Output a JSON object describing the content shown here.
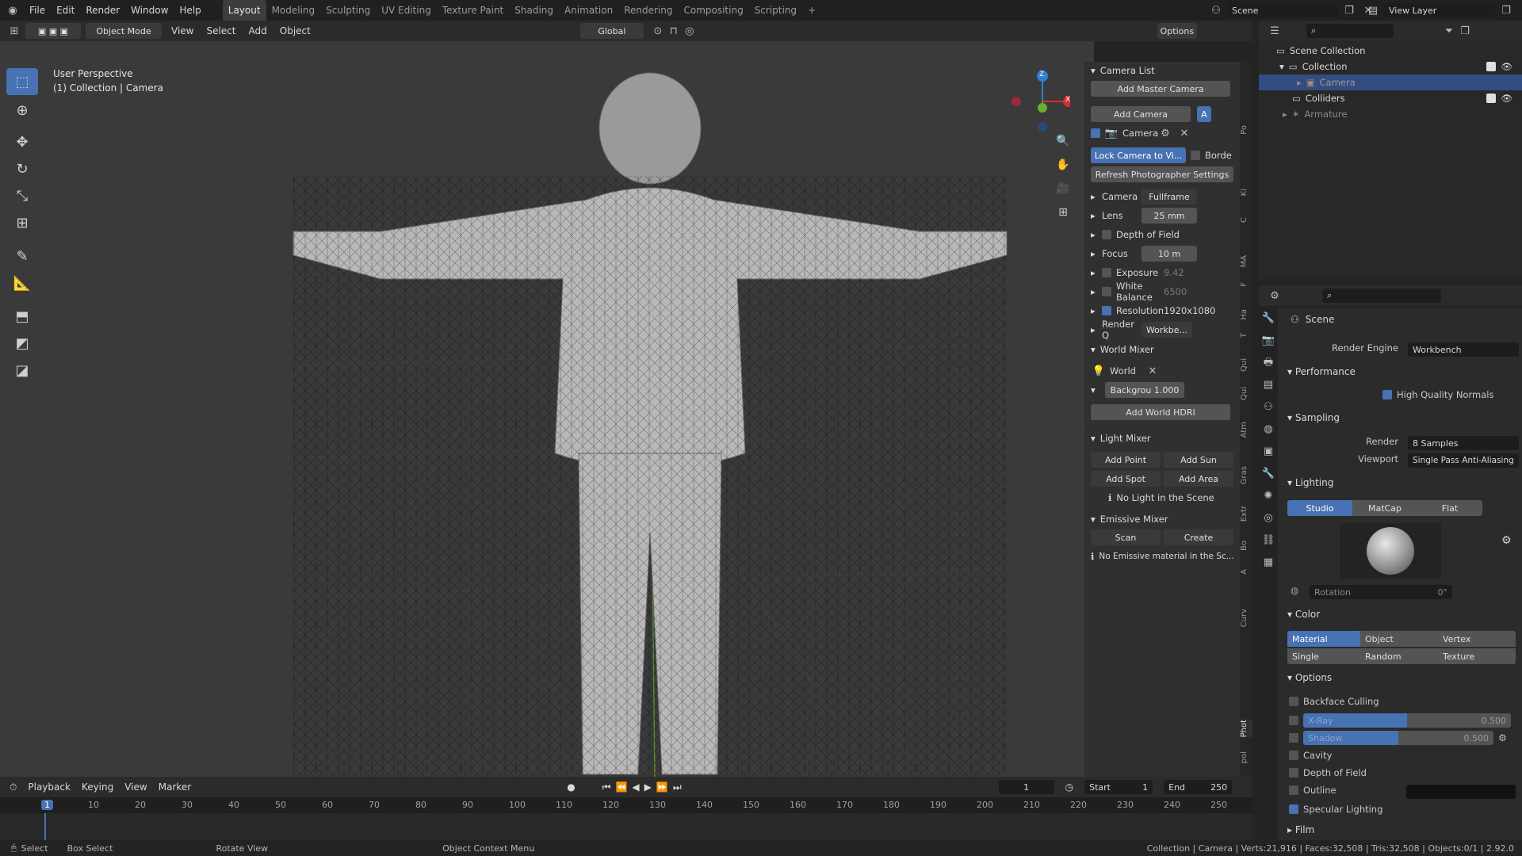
{
  "topmenu": {
    "file": "File",
    "edit": "Edit",
    "render": "Render",
    "window": "Window",
    "help": "Help"
  },
  "workspaces": [
    "Layout",
    "Modeling",
    "Sculpting",
    "UV Editing",
    "Texture Paint",
    "Shading",
    "Animation",
    "Rendering",
    "Compositing",
    "Scripting"
  ],
  "scene_name": "Scene",
  "view_layer": "View Layer",
  "vp_header": {
    "mode": "Object Mode",
    "view": "View",
    "select": "Select",
    "add": "Add",
    "object": "Object",
    "orientation": "Global",
    "options": "Options"
  },
  "overlay": {
    "perspective": "User Perspective",
    "context": "(1) Collection | Camera"
  },
  "gizmo": {
    "x": "X",
    "y": "Y",
    "z": "Z"
  },
  "npanel": {
    "camera_list": "Camera List",
    "add_master": "Add Master Camera",
    "add_camera": "Add Camera",
    "camera_item": "Camera",
    "lock_camera": "Lock Camera to Vi...",
    "border": "Borde",
    "refresh": "Refresh Photographer Settings",
    "camera_label": "Camera",
    "camera_val": "Fullframe",
    "lens": "Lens",
    "lens_val": "25 mm",
    "dof": "Depth of Field",
    "focus": "Focus",
    "focus_val": "10 m",
    "exposure": "Exposure",
    "exposure_val": "9.42",
    "wb": "White Balance",
    "wb_val": "6500",
    "resolution": "Resolution",
    "resolution_val": "1920x1080",
    "renderq": "Render Q",
    "renderq_val": "Workbe...",
    "world_mixer": "World Mixer",
    "world": "World",
    "background": "Backgrou",
    "background_val": "1.000",
    "add_hdri": "Add World HDRI",
    "light_mixer": "Light Mixer",
    "add_point": "Add Point",
    "add_sun": "Add Sun",
    "add_spot": "Add Spot",
    "add_area": "Add Area",
    "no_light": "No Light in the Scene",
    "emissive_mixer": "Emissive Mixer",
    "scan": "Scan",
    "create": "Create",
    "no_emissive": "No Emissive material in the Sc..."
  },
  "vtabs": [
    "Po",
    "Ki",
    "C",
    "MA",
    "F",
    "Ha",
    "T",
    "Qui",
    "Qui",
    "Atm",
    "Gras",
    "Extr",
    "Bo",
    "A",
    "Curv",
    "Phot",
    "pol"
  ],
  "outliner": {
    "scene_collection": "Scene Collection",
    "collection": "Collection",
    "camera": "Camera",
    "colliders": "Colliders",
    "armature": "Armature"
  },
  "props": {
    "scene": "Scene",
    "render_engine": "Render Engine",
    "engine_val": "Workbench",
    "performance": "Performance",
    "hq_normals": "High Quality Normals",
    "sampling": "Sampling",
    "render": "Render",
    "render_val": "8 Samples",
    "viewport": "Viewport",
    "viewport_val": "Single Pass Anti-Aliasing",
    "lighting": "Lighting",
    "studio": "Studio",
    "matcap": "MatCap",
    "flat": "Flat",
    "rotation": "Rotation",
    "rotation_val": "0°",
    "color": "Color",
    "material": "Material",
    "object": "Object",
    "vertex": "Vertex",
    "single": "Single",
    "random": "Random",
    "texture": "Texture",
    "options": "Options",
    "backface": "Backface Culling",
    "xray": "X-Ray",
    "xray_val": "0.500",
    "shadow": "Shadow",
    "shadow_val": "0.500",
    "cavity": "Cavity",
    "dof": "Depth of Field",
    "outline": "Outline",
    "specular": "Specular Lighting",
    "film": "Film"
  },
  "timeline": {
    "playback": "Playback",
    "keying": "Keying",
    "view": "View",
    "marker": "Marker",
    "frame": "1",
    "start_label": "Start",
    "start": "1",
    "end_label": "End",
    "end": "250",
    "ticks": [
      "1",
      "10",
      "20",
      "30",
      "40",
      "50",
      "60",
      "70",
      "80",
      "90",
      "100",
      "110",
      "120",
      "130",
      "140",
      "150",
      "160",
      "170",
      "180",
      "190",
      "200",
      "210",
      "220",
      "230",
      "240",
      "250"
    ]
  },
  "status": {
    "select": "Select",
    "box_select": "Box Select",
    "rotate": "Rotate View",
    "context": "Object Context Menu",
    "stats": "Collection | Camera | Verts:21,916 | Faces:32,508 | Tris:32,508 | Objects:0/1 | 2.92.0"
  }
}
